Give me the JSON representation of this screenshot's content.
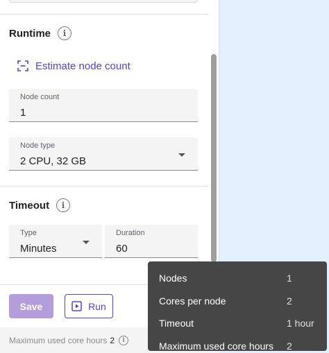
{
  "runtime": {
    "title": "Runtime",
    "estimate_label": "Estimate node count",
    "node_count": {
      "label": "Node count",
      "value": "1"
    },
    "node_type": {
      "label": "Node type",
      "value": "2 CPU, 32 GB"
    }
  },
  "timeout": {
    "title": "Timeout",
    "type": {
      "label": "Type",
      "value": "Minutes"
    },
    "duration": {
      "label": "Duration",
      "value": "60"
    }
  },
  "actions": {
    "save_label": "Save",
    "run_label": "Run"
  },
  "footer": {
    "core_hours_label": "Maximum used core hours",
    "core_hours_value": "2"
  },
  "tooltip": {
    "rows": [
      {
        "key": "Nodes",
        "value": "1"
      },
      {
        "key": "Cores per node",
        "value": "2"
      },
      {
        "key": "Timeout",
        "value": "1 hour"
      },
      {
        "key": "Maximum used core hours",
        "value": "2"
      }
    ]
  },
  "colors": {
    "accent": "#5b41c9",
    "save_disabled": "#b39ddb",
    "tooltip_bg": "#464646",
    "background": "#e3f0fd"
  }
}
